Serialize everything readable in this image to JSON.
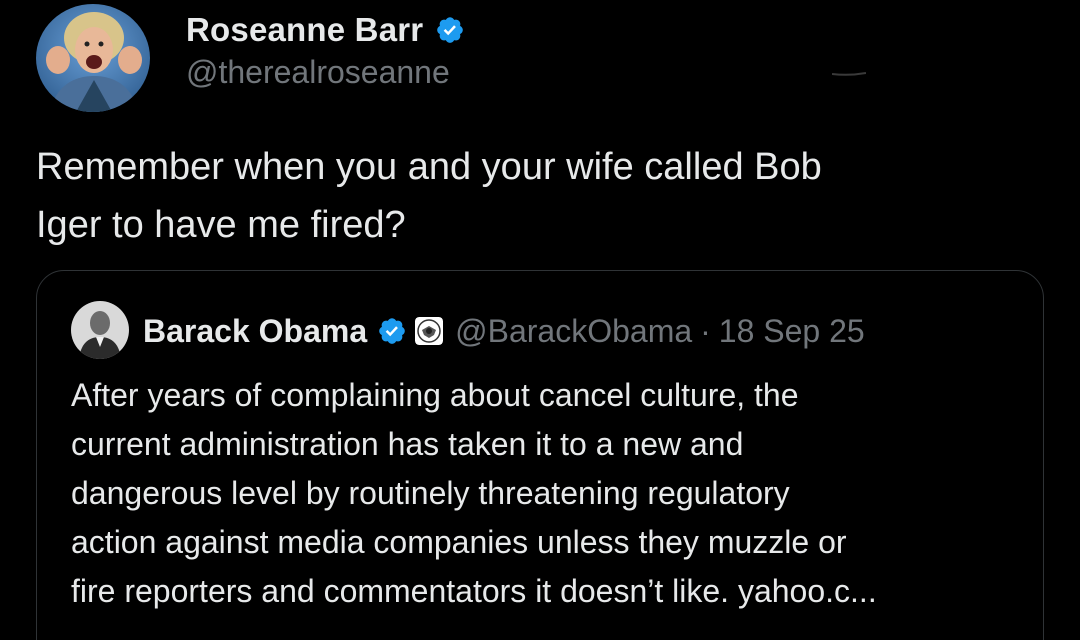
{
  "tweet": {
    "author": {
      "display_name": "Roseanne Barr",
      "handle": "@therealroseanne",
      "verified": true,
      "verified_color": "#1d9bf0"
    },
    "text_lines": [
      "Remember when you and your wife called Bob",
      "Iger to have me fired?"
    ]
  },
  "quoted_tweet": {
    "author": {
      "display_name": "Barack Obama",
      "handle": "@BarackObama",
      "verified": true,
      "affiliation_icon": "presidential-seal-icon"
    },
    "separator": "·",
    "date": "18 Sep 25",
    "text_lines": [
      "After years of complaining about cancel culture, the",
      "current administration has taken it to a new and",
      "dangerous level by routinely threatening regulatory",
      "action against media companies unless they muzzle or",
      "fire reporters and commentators it doesn’t like. yahoo.c..."
    ]
  },
  "colors": {
    "background": "#000000",
    "primary_text": "#e7e9ea",
    "secondary_text": "#71767b",
    "border": "#2f3336",
    "verified_blue": "#1d9bf0"
  }
}
